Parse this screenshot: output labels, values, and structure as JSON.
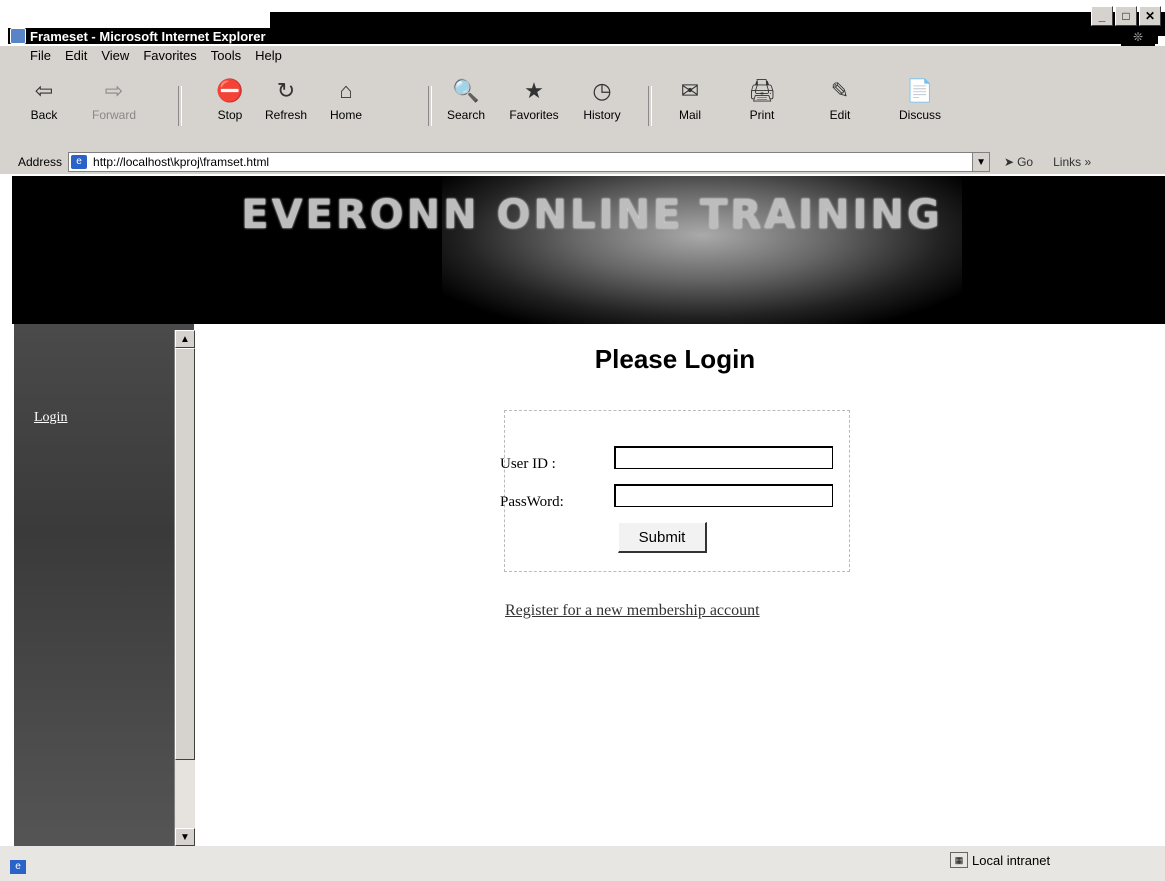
{
  "window": {
    "title": "Frameset - Microsoft Internet Explorer",
    "minimize": "_",
    "maximize": "□",
    "close": "✕"
  },
  "menu": [
    "File",
    "Edit",
    "View",
    "Favorites",
    "Tools",
    "Help"
  ],
  "toolbar": {
    "back": "Back",
    "forward": "Forward",
    "stop": "Stop",
    "refresh": "Refresh",
    "home": "Home",
    "search": "Search",
    "favorites": "Favorites",
    "history": "History",
    "mail": "Mail",
    "print": "Print",
    "edit": "Edit",
    "discuss": "Discuss"
  },
  "address": {
    "label": "Address",
    "url": "http://localhost\\kproj\\framset.html",
    "go": "Go",
    "links": "Links »"
  },
  "banner": {
    "title": "EVERONN ONLINE TRAINING"
  },
  "sidebar": {
    "link": "Login"
  },
  "main": {
    "heading": "Please Login",
    "user_label": "User ID :",
    "password_label": "PassWord:",
    "user_value": "",
    "password_value": "",
    "submit": "Submit",
    "register": "Register for a new membership account"
  },
  "status": {
    "zone": "Local intranet"
  },
  "colors": {
    "chrome": "#d6d3ce",
    "titlebar": "#000000",
    "banner": "#000000",
    "sidebar": "#4a4a4a"
  }
}
